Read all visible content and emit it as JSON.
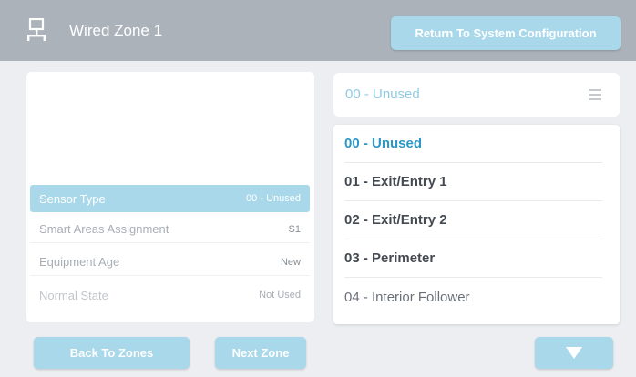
{
  "header": {
    "title": "Wired Zone 1",
    "icon": "network-icon",
    "return_label": "Return To System Configuration"
  },
  "settings": {
    "rows": [
      {
        "label": "Sensor Type",
        "value": "00 - Unused"
      },
      {
        "label": "Smart Areas Assignment",
        "value": "S1"
      },
      {
        "label": "Equipment Age",
        "value": "New"
      },
      {
        "label": "Normal State",
        "value": "Not Used"
      }
    ]
  },
  "sensor_select": {
    "selected": "00 - Unused",
    "icon": "menu-icon",
    "options": [
      "00 - Unused",
      "01 - Exit/Entry 1",
      "02 - Exit/Entry 2",
      "03 - Perimeter",
      "04 - Interior Follower"
    ]
  },
  "footer": {
    "back_label": "Back To Zones",
    "next_label": "Next Zone",
    "scroll_icon": "down-arrow-icon"
  },
  "colors": {
    "header": "#abb2ba",
    "button": "#a9d8ea",
    "accent_text": "#2c97c5",
    "background": "#eceef1"
  }
}
